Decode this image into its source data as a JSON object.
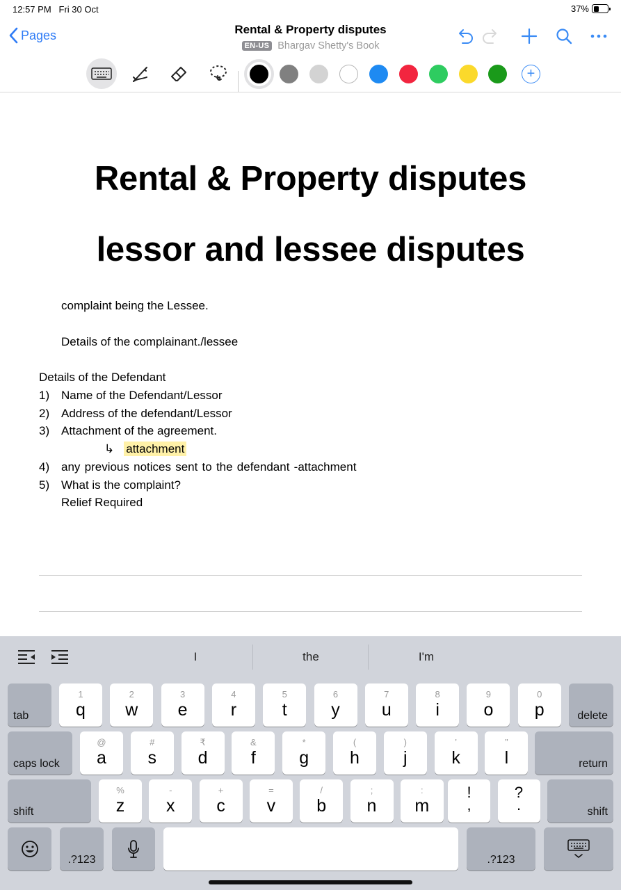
{
  "status_bar": {
    "time": "12:57 PM",
    "date": "Fri 30 Oct",
    "battery": "37%",
    "battery_level": 0.37
  },
  "navbar": {
    "back_label": "Pages",
    "title": "Rental & Property disputes",
    "language": "EN-US",
    "book": "Bhargav Shetty's Book",
    "actions": [
      "undo-icon",
      "redo-icon",
      "add-icon",
      "search-icon",
      "more-icon"
    ]
  },
  "toolbar": {
    "tools": [
      "keyboard-icon",
      "pen-icon",
      "eraser-icon",
      "lasso-icon"
    ],
    "active_tool": "keyboard-icon",
    "colors": [
      "#000000",
      "#808080",
      "#d3d3d3",
      "#ffffff",
      "#1e8af2",
      "#f2253f",
      "#2ecc60",
      "#fbd92b",
      "#1a9a1a"
    ],
    "selected_color": "#000000",
    "add_color_label": "+"
  },
  "document": {
    "heading1": "Rental & Property disputes",
    "heading2": "lessor and lessee disputes",
    "line1": "complaint being the Lessee.",
    "line2": "Details of the complainant./lessee",
    "defendant_heading": "Details of the Defendant",
    "items": [
      {
        "num": "1)",
        "text": "Name of the Defendant/Lessor"
      },
      {
        "num": "2)",
        "text": "Address of the defendant/Lessor"
      },
      {
        "num": "3)",
        "text": "Attachment of the agreement."
      },
      {
        "num": "4)",
        "text": "any previous notices sent to the defendant -attachment"
      },
      {
        "num": "5)",
        "text": "What is the complaint?"
      }
    ],
    "sub_arrow": "↳",
    "attachment": "attachment",
    "relief": "Relief Required"
  },
  "keyboard": {
    "suggestions": [
      "I",
      "the",
      "I'm"
    ],
    "row1": {
      "tab": "tab",
      "delete": "delete",
      "keys": [
        [
          "1",
          "q"
        ],
        [
          "2",
          "w"
        ],
        [
          "3",
          "e"
        ],
        [
          "4",
          "r"
        ],
        [
          "5",
          "t"
        ],
        [
          "6",
          "y"
        ],
        [
          "7",
          "u"
        ],
        [
          "8",
          "i"
        ],
        [
          "9",
          "o"
        ],
        [
          "0",
          "p"
        ]
      ]
    },
    "row2": {
      "caps": "caps lock",
      "return": "return",
      "keys": [
        [
          "@",
          "a"
        ],
        [
          "#",
          "s"
        ],
        [
          "₹",
          "d"
        ],
        [
          "&",
          "f"
        ],
        [
          "*",
          "g"
        ],
        [
          "(",
          "h"
        ],
        [
          ")",
          "j"
        ],
        [
          "’",
          "k"
        ],
        [
          "”",
          "l"
        ]
      ]
    },
    "row3": {
      "shift": "shift",
      "keys": [
        [
          "%",
          "z"
        ],
        [
          "-",
          "x"
        ],
        [
          "+",
          "c"
        ],
        [
          "=",
          "v"
        ],
        [
          "/",
          "b"
        ],
        [
          ";",
          "n"
        ],
        [
          ":",
          "m"
        ]
      ],
      "punc": [
        [
          "!",
          ","
        ],
        [
          "?",
          "."
        ]
      ]
    },
    "row4": {
      "numbers_label": ".?123"
    }
  }
}
